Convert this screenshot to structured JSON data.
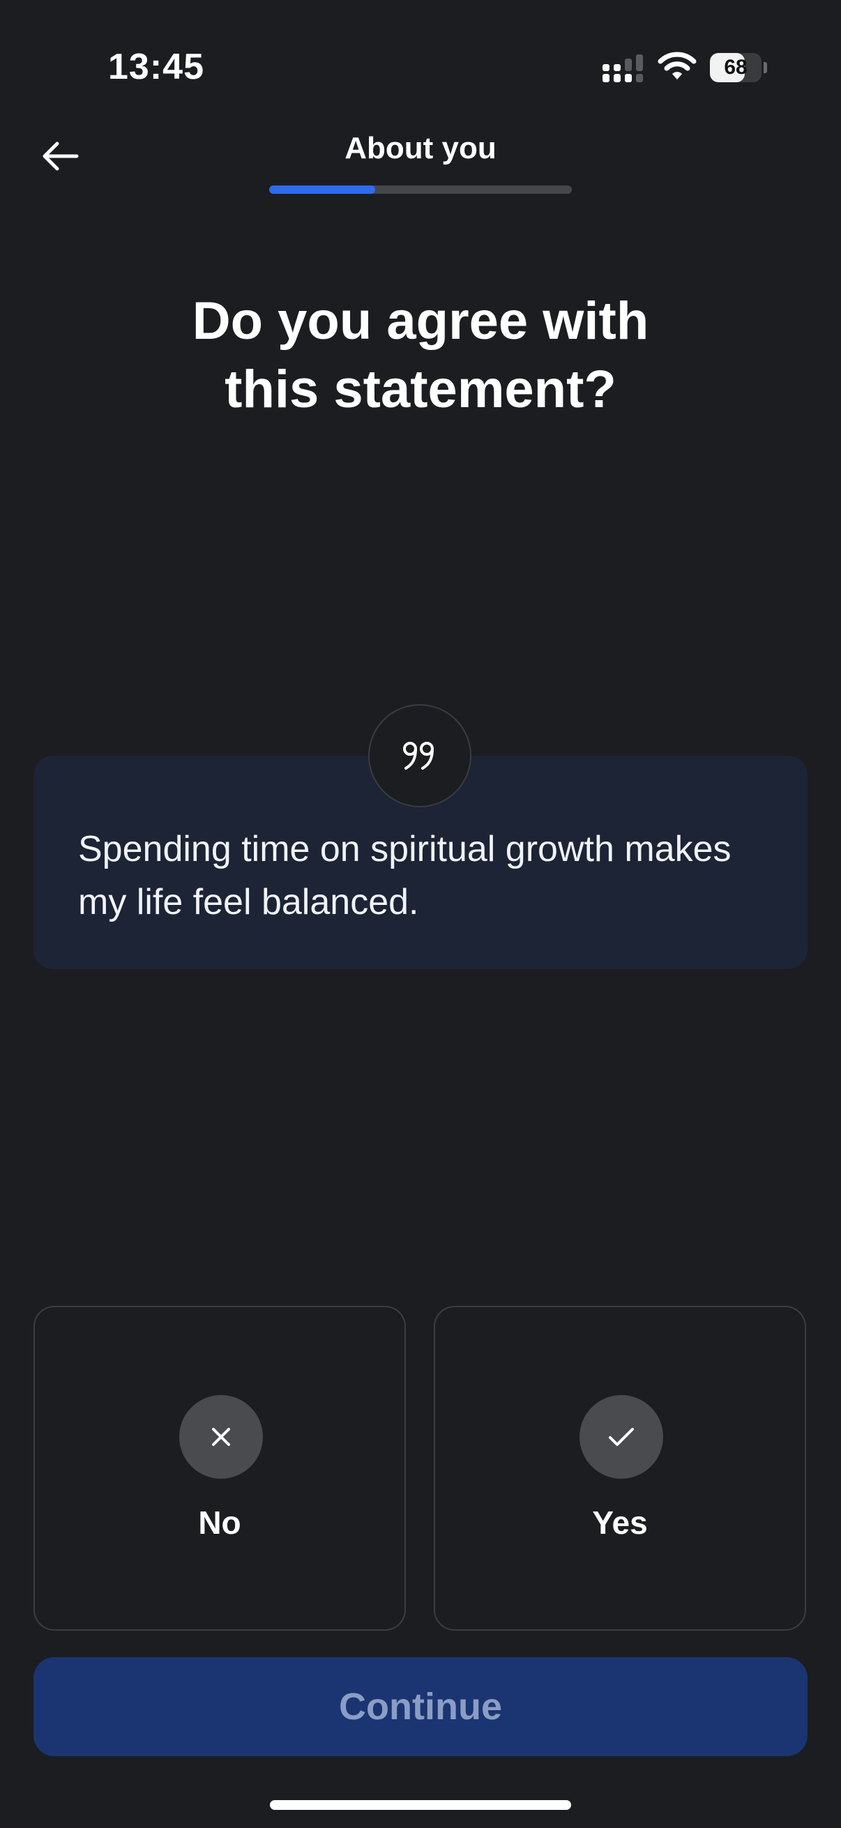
{
  "status_bar": {
    "time": "13:45",
    "battery_level": "68",
    "battery_percent": 68,
    "icons": [
      "signal-icon",
      "wifi-icon",
      "battery-icon"
    ]
  },
  "header": {
    "title": "About you",
    "back_icon": "arrow-left-icon",
    "progress_percent": 35
  },
  "question": {
    "line1": "Do you agree with",
    "line2": "this statement?"
  },
  "statement": {
    "icon": "quote-icon",
    "text": "Spending time on spiritual growth makes my life feel balanced."
  },
  "options": [
    {
      "label": "No",
      "icon": "close-icon"
    },
    {
      "label": "Yes",
      "icon": "check-icon"
    }
  ],
  "continue_button": {
    "label": "Continue",
    "enabled": false
  },
  "colors": {
    "background": "#1c1d20",
    "accent": "#2e6bf0",
    "card": "#1c2435",
    "button_disabled": "#1b3573",
    "button_text_disabled": "#8b9dc4"
  }
}
